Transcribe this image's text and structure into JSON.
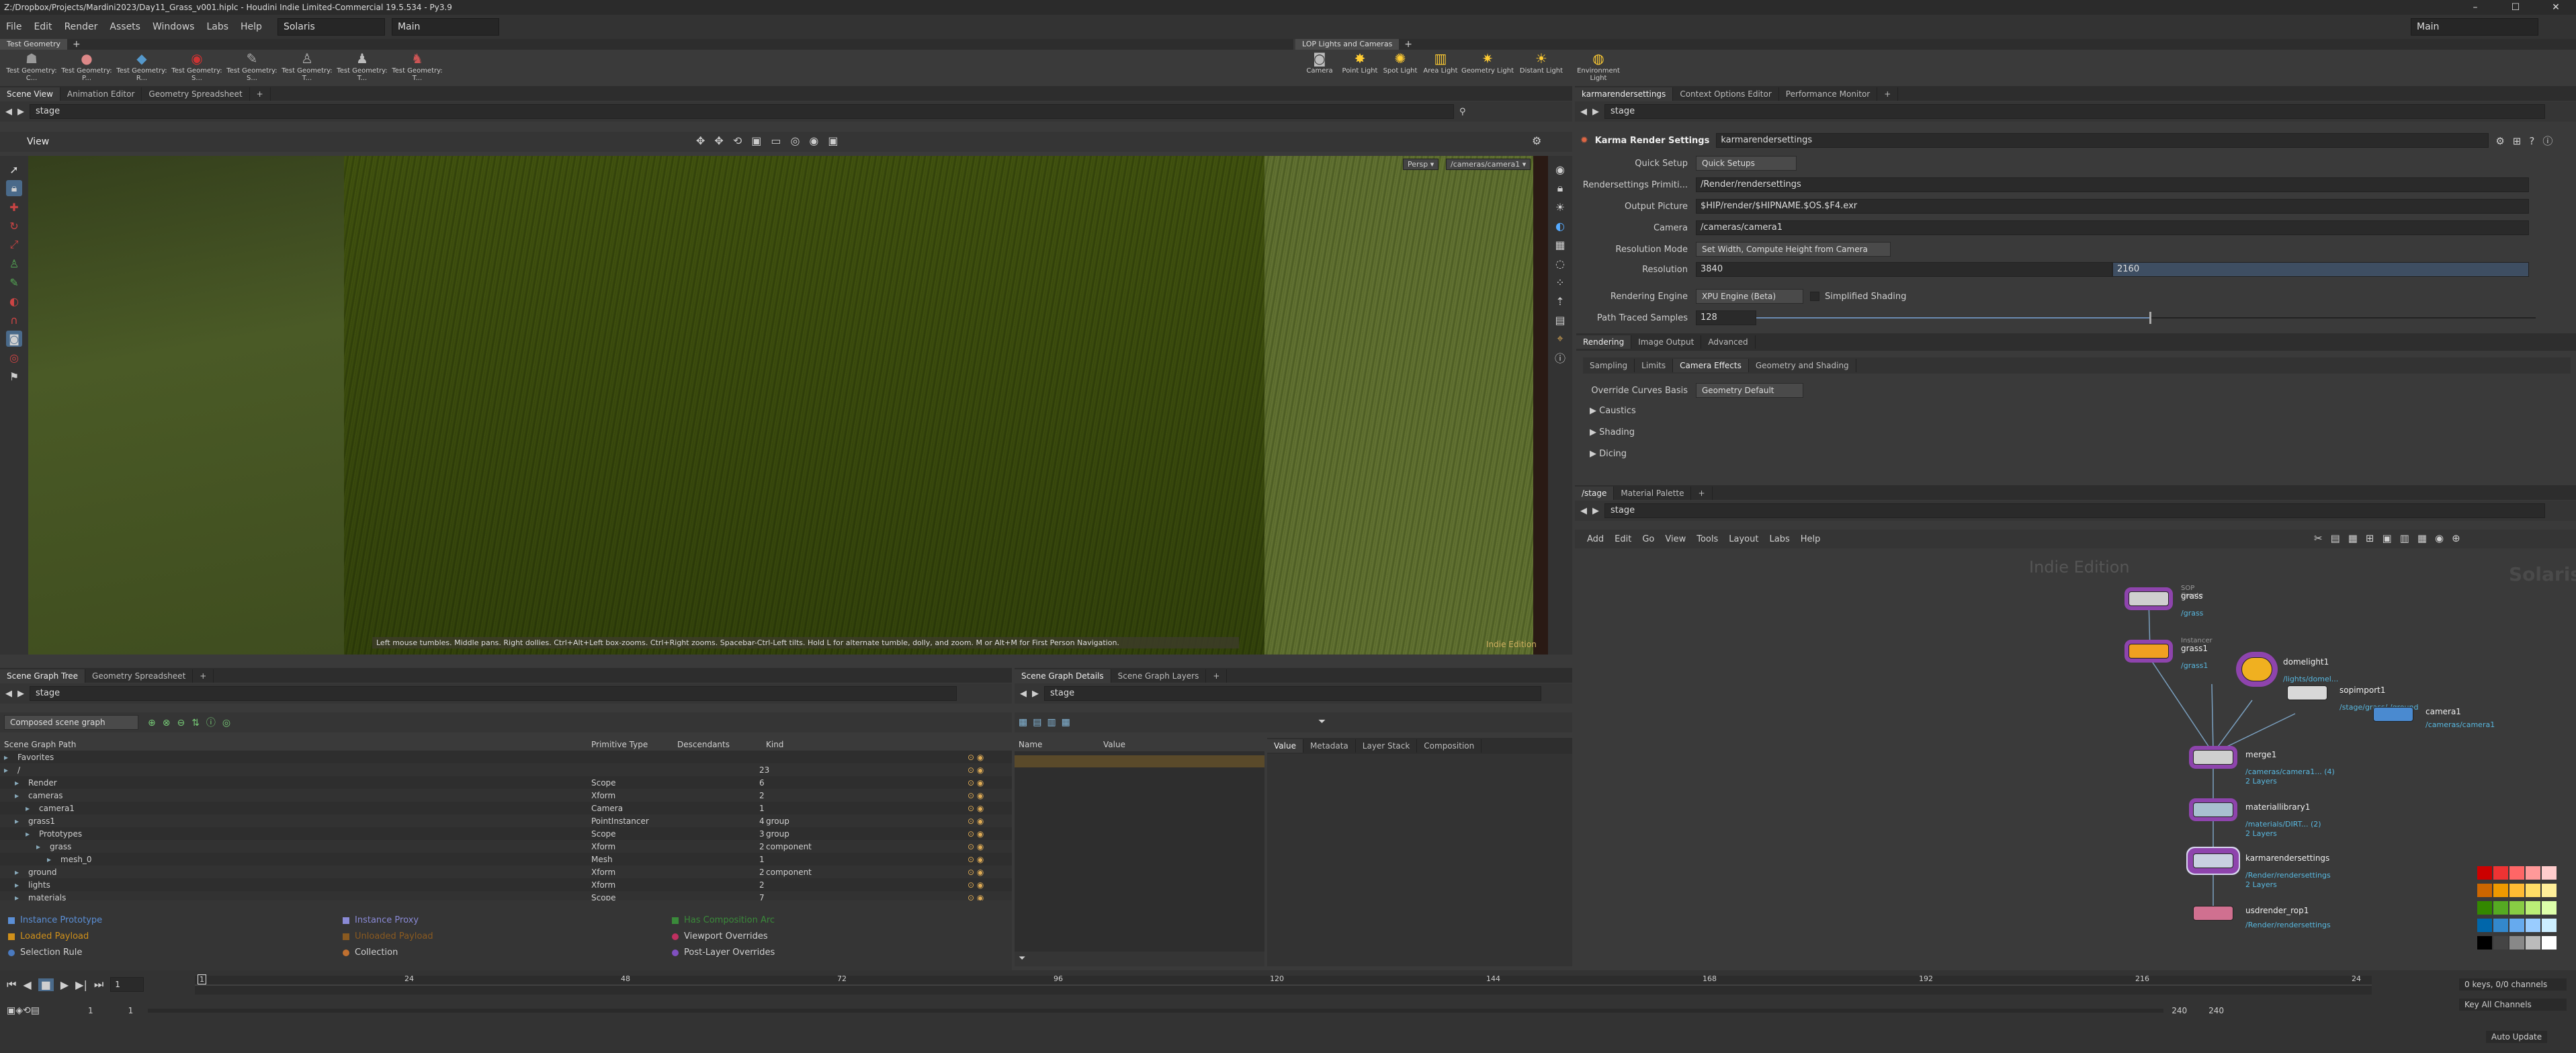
{
  "window": {
    "title": "Z:/Dropbox/Projects/Mardini2023/Day11_Grass_v001.hiplc - Houdini Indie Limited-Commercial 19.5.534 - Py3.9",
    "min": "–",
    "max": "☐",
    "close": "✕"
  },
  "menubar": {
    "items": [
      "File",
      "Edit",
      "Render",
      "Assets",
      "Windows",
      "Labs",
      "Help"
    ],
    "desktop": "Solaris",
    "context": "Main",
    "right_desktop": "Main"
  },
  "shelf_left": {
    "tab": "Test Geometry",
    "tools": [
      "Test Geometry: C...",
      "Test Geometry: P...",
      "Test Geometry: R...",
      "Test Geometry: S...",
      "Test Geometry: S...",
      "Test Geometry: T...",
      "Test Geometry: T...",
      "Test Geometry: T..."
    ]
  },
  "shelf_right": {
    "tab": "LOP Lights and Cameras",
    "tools": [
      "Camera",
      "Point Light",
      "Spot Light",
      "Area Light",
      "Geometry Light",
      "Distant Light",
      "Environment Light"
    ]
  },
  "left_top": {
    "tabs": [
      "Scene View",
      "Animation Editor",
      "Geometry Spreadsheet"
    ],
    "path": "stage",
    "view_label": "View",
    "persp": "Persp ▾",
    "camera": "/cameras/camera1 ▾",
    "hint": "Left mouse tumbles. Middle pans. Right dollies. Ctrl+Alt+Left box-zooms. Ctrl+Right zooms. Spacebar-Ctrl-Left tilts. Hold L for alternate tumble, dolly, and zoom.    M or Alt+M for First Person Navigation.",
    "edition": "Indie Edition"
  },
  "params": {
    "tabs": [
      "karmarendersettings",
      "Context Options Editor",
      "Performance Monitor"
    ],
    "path": "stage",
    "node_type": "Karma Render Settings",
    "node_name": "karmarendersettings",
    "rows": [
      {
        "label": "Quick Setup",
        "value": "Quick Setups"
      },
      {
        "label": "Rendersettings Primiti...",
        "value": "/Render/rendersettings"
      },
      {
        "label": "Output Picture",
        "value": "$HIP/render/$HIPNAME.$OS.$F4.exr"
      },
      {
        "label": "Camera",
        "value": "/cameras/camera1"
      },
      {
        "label": "Resolution Mode",
        "value": "Set Width, Compute Height from Camera"
      },
      {
        "label": "Resolution",
        "value": "3840",
        "value2": "2160"
      },
      {
        "label": "Rendering Engine",
        "value": "XPU Engine (Beta)",
        "check": "Simplified Shading"
      },
      {
        "label": "Path Traced Samples",
        "value": "128"
      }
    ],
    "tabs2": [
      "Rendering",
      "Image Output",
      "Advanced"
    ],
    "tabs3": [
      "Sampling",
      "Limits",
      "Camera Effects",
      "Geometry and Shading"
    ],
    "override_label": "Override Curves Basis",
    "override_value": "Geometry Default",
    "folders": [
      "Caustics",
      "Shading",
      "Dicing"
    ]
  },
  "network": {
    "tabs": [
      "/stage",
      "Material Palette"
    ],
    "path": "stage",
    "menu": [
      "Add",
      "Edit",
      "Go",
      "View",
      "Tools",
      "Layout",
      "Labs",
      "Help"
    ],
    "watermark": "Indie Edition",
    "context": "Solaris",
    "nodes": [
      {
        "name": "grass",
        "type": "SOP Create",
        "sub": "/grass"
      },
      {
        "name": "grass1",
        "type": "Instancer",
        "sub": "/grass1"
      },
      {
        "name": "domelight1",
        "sub": "/lights/domel..."
      },
      {
        "name": "sopimport1",
        "sub": "/stage/grass/ /ground"
      },
      {
        "name": "camera1",
        "sub": "/cameras/camera1"
      },
      {
        "name": "merge1",
        "sub": "/cameras/camera1... (4)",
        "sub2": "2 Layers"
      },
      {
        "name": "materiallibrary1",
        "sub": "/materials/DIRT... (2)",
        "sub2": "2 Layers"
      },
      {
        "name": "karmarendersettings",
        "sub": "/Render/rendersettings",
        "sub2": "2 Layers"
      },
      {
        "name": "usdrender_rop1",
        "sub": "/Render/rendersettings"
      }
    ]
  },
  "scene_tree": {
    "tabs": [
      "Scene Graph Tree",
      "Geometry Spreadsheet"
    ],
    "path": "stage",
    "filter": "Composed scene graph",
    "columns": [
      "Scene Graph Path",
      "Primitive Type",
      "Descendants",
      "Kind"
    ],
    "rows": [
      {
        "path": "Favorites",
        "type": "",
        "desc": "",
        "kind": "",
        "indent": 0
      },
      {
        "path": "/",
        "type": "",
        "desc": "23",
        "kind": "",
        "indent": 0
      },
      {
        "path": "Render",
        "type": "Scope",
        "desc": "6",
        "kind": "",
        "indent": 1
      },
      {
        "path": "cameras",
        "type": "Xform",
        "desc": "2",
        "kind": "",
        "indent": 1
      },
      {
        "path": "camera1",
        "type": "Camera",
        "desc": "1",
        "kind": "",
        "indent": 2
      },
      {
        "path": "grass1",
        "type": "PointInstancer",
        "desc": "4",
        "kind": "group",
        "indent": 1
      },
      {
        "path": "Prototypes",
        "type": "Scope",
        "desc": "3",
        "kind": "group",
        "indent": 2
      },
      {
        "path": "grass",
        "type": "Xform",
        "desc": "2",
        "kind": "component",
        "indent": 3
      },
      {
        "path": "mesh_0",
        "type": "Mesh",
        "desc": "1",
        "kind": "",
        "indent": 4
      },
      {
        "path": "ground",
        "type": "Xform",
        "desc": "2",
        "kind": "component",
        "indent": 1
      },
      {
        "path": "lights",
        "type": "Xform",
        "desc": "2",
        "kind": "",
        "indent": 1
      },
      {
        "path": "materials",
        "type": "Scope",
        "desc": "7",
        "kind": "",
        "indent": 1
      }
    ],
    "legend": [
      [
        "Instance Prototype",
        "Instance Proxy",
        "Has Composition Arc"
      ],
      [
        "Loaded Payload",
        "Unloaded Payload",
        "Viewport Overrides"
      ],
      [
        "Selection Rule",
        "Collection",
        "Post-Layer Overrides"
      ]
    ]
  },
  "details": {
    "tabs": [
      "Scene Graph Details",
      "Scene Graph Layers"
    ],
    "path": "stage",
    "col_name": "Name",
    "col_value": "Value",
    "subtabs": [
      "Value",
      "Metadata",
      "Layer Stack",
      "Composition"
    ]
  },
  "timeline": {
    "ticks": [
      "1",
      "24",
      "48",
      "72",
      "96",
      "120",
      "144",
      "168",
      "192",
      "216",
      "24"
    ],
    "frame": "1",
    "start": "1",
    "end_a": "1",
    "range_end": "240",
    "range_end2": "240",
    "keys": "0 keys, 0/0 channels",
    "key_all": "Key All Channels",
    "auto_update": "Auto Update"
  },
  "colors": {
    "accent": "#f0c040",
    "node_sel": "#9b59b6",
    "path_blue": "#58b8e0"
  }
}
